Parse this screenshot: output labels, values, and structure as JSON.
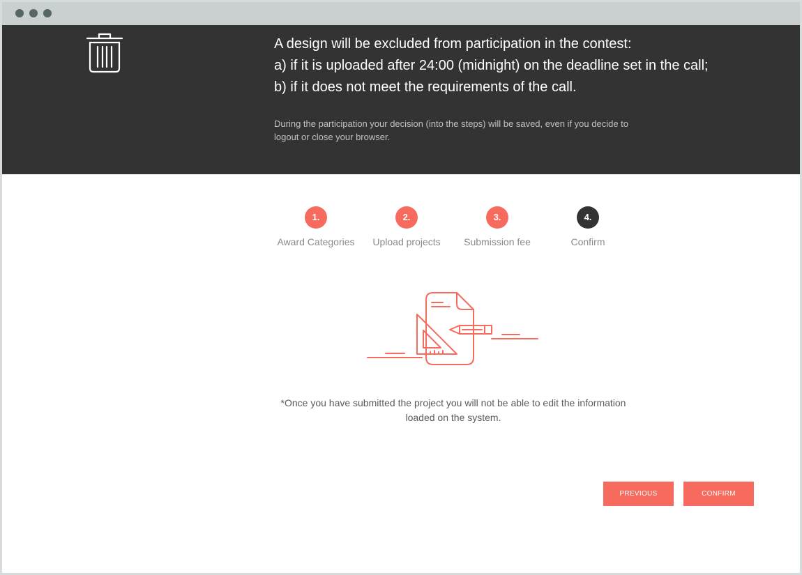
{
  "banner": {
    "lines": [
      "A design will be excluded from participation in the contest:",
      "a) if it is uploaded after 24:00 (midnight) on the deadline set in the call;",
      "b) if it does not meet the requirements of the call."
    ],
    "note": "During the participation your decision (into the steps) will be saved, even if you decide to logout or close your browser.",
    "icon": "trash-icon"
  },
  "steps": [
    {
      "number": "1.",
      "label": "Award Categories",
      "state": "completed"
    },
    {
      "number": "2.",
      "label": "Upload projects",
      "state": "completed"
    },
    {
      "number": "3.",
      "label": "Submission fee",
      "state": "completed"
    },
    {
      "number": "4.",
      "label": "Confirm",
      "state": "current"
    }
  ],
  "illustration": {
    "icon": "document-pencil-triangle-icon"
  },
  "note": "*Once you have submitted the project you will not be able to edit the information loaded on the system.",
  "buttons": {
    "previous": "PREVIOUS",
    "confirm": "CONFIRM"
  },
  "colors": {
    "accent": "#f76b5f",
    "banner_bg": "#333333",
    "active_step": "#333333",
    "titlebar": "#c9d0cf"
  }
}
